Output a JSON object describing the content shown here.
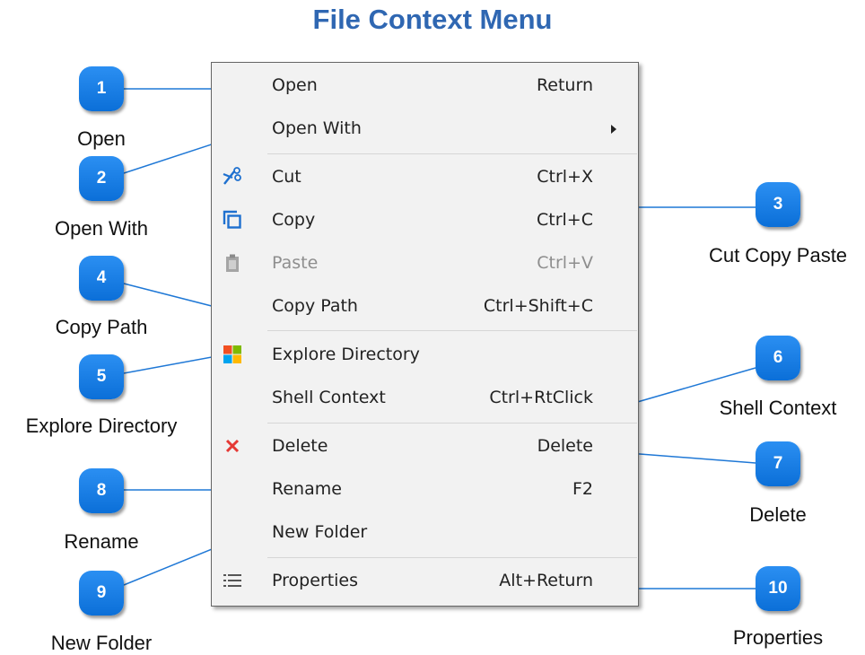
{
  "title": "File Context Menu",
  "menu": {
    "items": [
      {
        "label": "Open",
        "shortcut": "Return"
      },
      {
        "label": "Open With",
        "shortcut": ""
      },
      {
        "label": "Cut",
        "shortcut": "Ctrl+X"
      },
      {
        "label": "Copy",
        "shortcut": "Ctrl+C"
      },
      {
        "label": "Paste",
        "shortcut": "Ctrl+V"
      },
      {
        "label": "Copy Path",
        "shortcut": "Ctrl+Shift+C"
      },
      {
        "label": "Explore Directory",
        "shortcut": ""
      },
      {
        "label": "Shell Context",
        "shortcut": "Ctrl+RtClick"
      },
      {
        "label": "Delete",
        "shortcut": "Delete"
      },
      {
        "label": "Rename",
        "shortcut": "F2"
      },
      {
        "label": "New Folder",
        "shortcut": ""
      },
      {
        "label": "Properties",
        "shortcut": "Alt+Return"
      }
    ]
  },
  "callouts": [
    {
      "number": "1",
      "text": "Open"
    },
    {
      "number": "2",
      "text": "Open With"
    },
    {
      "number": "3",
      "text": "Cut Copy Paste"
    },
    {
      "number": "4",
      "text": "Copy Path"
    },
    {
      "number": "5",
      "text": "Explore Directory"
    },
    {
      "number": "6",
      "text": "Shell Context"
    },
    {
      "number": "7",
      "text": "Delete"
    },
    {
      "number": "8",
      "text": "Rename"
    },
    {
      "number": "9",
      "text": "New Folder"
    },
    {
      "number": "10",
      "text": "Properties"
    }
  ],
  "colors": {
    "title": "#2f67b2",
    "badge": "#1580ea",
    "line": "#1f78d6",
    "delete": "#e53935"
  }
}
